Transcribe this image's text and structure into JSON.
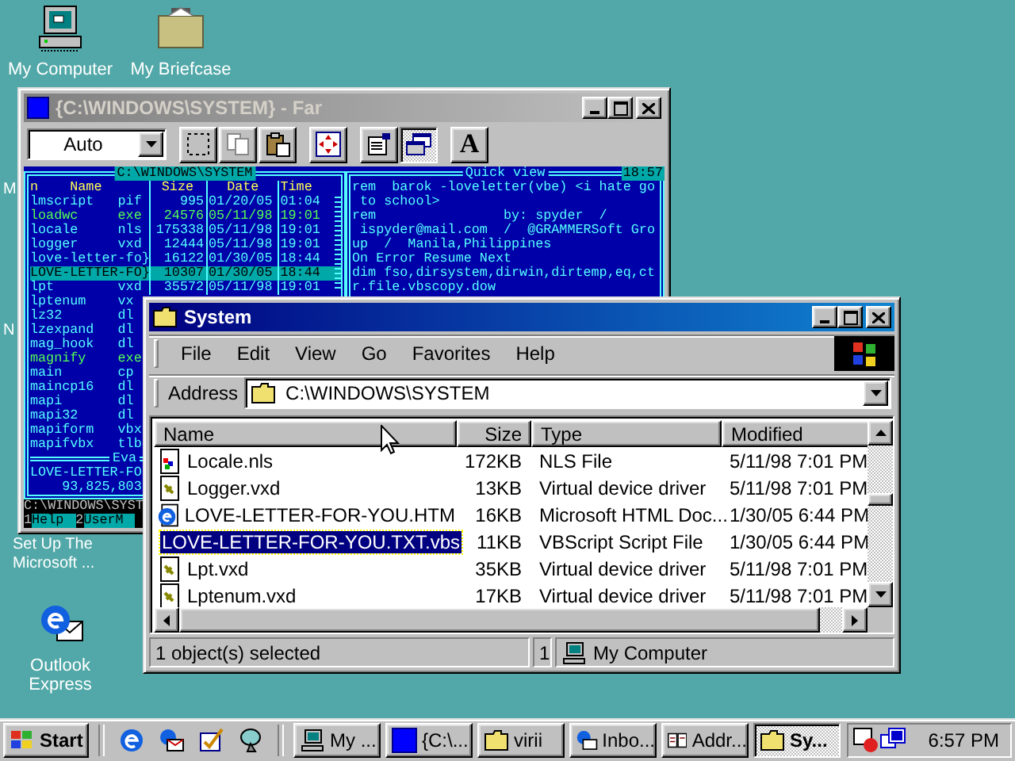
{
  "desktop": {
    "icons": [
      {
        "label": "My Computer",
        "kind": "computer"
      },
      {
        "label": "My Briefcase",
        "kind": "briefcase"
      },
      {
        "label": "M",
        "kind": "covered"
      },
      {
        "label": "N",
        "kind": "covered"
      },
      {
        "label": "Set Up The Microsoft ...",
        "kind": "covered"
      },
      {
        "label": "Outlook Express",
        "kind": "outlook"
      }
    ]
  },
  "far": {
    "title": "{C:\\WINDOWS\\SYSTEM} - Far",
    "view_mode": "Auto",
    "font_button": "A",
    "left_panel": {
      "path": "C:\\WINDOWS\\SYSTEM",
      "columns": [
        "n",
        "Name",
        "Size",
        "Date",
        "Time"
      ],
      "rows": [
        {
          "name": "lmscript",
          "ext": "pif",
          "size": "995",
          "date": "01/20/05",
          "time": "01:04",
          "color": "#55ffff",
          "selected": false
        },
        {
          "name": "loadwc",
          "ext": "exe",
          "size": "24576",
          "date": "05/11/98",
          "time": "19:01",
          "color": "#55ff55",
          "selected": false
        },
        {
          "name": "locale",
          "ext": "nls",
          "size": "175338",
          "date": "05/11/98",
          "time": "19:01",
          "color": "#55ffff",
          "selected": false
        },
        {
          "name": "logger",
          "ext": "vxd",
          "size": "12444",
          "date": "05/11/98",
          "time": "19:01",
          "color": "#55ffff",
          "selected": false
        },
        {
          "name": "love-letter-fo}",
          "size": "16122",
          "date": "01/30/05",
          "time": "18:44",
          "color": "#55ffff",
          "selected": false
        },
        {
          "name": "LOVE-LETTER-FO}",
          "size": "10307",
          "date": "01/30/05",
          "time": "18:44",
          "selected": true
        },
        {
          "name": "lpt",
          "ext": "vxd",
          "size": "35572",
          "date": "05/11/98",
          "time": "19:01",
          "color": "#55ffff",
          "selected": false
        },
        {
          "name": "lptenum",
          "ext": "vx",
          "color": "#55ffff",
          "selected": false
        },
        {
          "name": "lz32",
          "ext": "dl",
          "color": "#55ffff",
          "selected": false
        },
        {
          "name": "lzexpand",
          "ext": "dl",
          "color": "#55ffff",
          "selected": false
        },
        {
          "name": "mag_hook",
          "ext": "dl",
          "color": "#55ffff",
          "selected": false
        },
        {
          "name": "magnify",
          "ext": "exe",
          "color": "#55ff55",
          "selected": false
        },
        {
          "name": "main",
          "ext": "cp",
          "color": "#55ffff",
          "selected": false
        },
        {
          "name": "maincp16",
          "ext": "dl",
          "color": "#55ffff",
          "selected": false
        },
        {
          "name": "mapi",
          "ext": "dl",
          "color": "#55ffff",
          "selected": false
        },
        {
          "name": "mapi32",
          "ext": "dl",
          "color": "#55ffff",
          "selected": false
        },
        {
          "name": "mapiform",
          "ext": "vbx",
          "color": "#55ffff",
          "selected": false
        },
        {
          "name": "mapifvbx",
          "ext": "tlb",
          "color": "#55ffff",
          "selected": false
        }
      ],
      "info": "Eva",
      "current": "LOVE-LETTER-FO",
      "total": "93,825,803"
    },
    "quick_view": {
      "title": "Quick view",
      "clock": "18:57",
      "lines": [
        "rem  barok -loveletter(vbe) <i hate go",
        " to school>",
        "rem                by: spyder  /",
        " ispyder@mail.com  /  @GRAMMERSoft Gro",
        "up  /  Manila,Philippines",
        "On Error Resume Next",
        "dim fso,dirsystem,dirwin,dirtemp,eq,ct",
        "r.file.vbscopy.dow"
      ]
    },
    "command_line": "C:\\WINDOWS\\SYST",
    "keybar": [
      {
        "number": "1",
        "label": "Help"
      },
      {
        "number": "2",
        "label": "UserM"
      }
    ]
  },
  "explorer": {
    "title": "System",
    "menu": [
      "File",
      "Edit",
      "View",
      "Go",
      "Favorites",
      "Help"
    ],
    "address": {
      "label": "Address",
      "value": "C:\\WINDOWS\\SYSTEM"
    },
    "columns": [
      "Name",
      "Size",
      "Type",
      "Modified"
    ],
    "rows": [
      {
        "name": "Locale.nls",
        "size": "172KB",
        "type": "NLS File",
        "modified": "5/11/98 7:01 PM",
        "kind": "nls",
        "selected": false
      },
      {
        "name": "Logger.vxd",
        "size": "13KB",
        "type": "Virtual device driver",
        "modified": "5/11/98 7:01 PM",
        "kind": "vxd",
        "selected": false
      },
      {
        "name": "LOVE-LETTER-FOR-YOU.HTM",
        "size": "16KB",
        "type": "Microsoft HTML Doc...",
        "modified": "1/30/05 6:44 PM",
        "kind": "htm",
        "selected": false
      },
      {
        "name": "LOVE-LETTER-FOR-YOU.TXT.vbs",
        "size": "11KB",
        "type": "VBScript Script File",
        "modified": "1/30/05 6:44 PM",
        "kind": "vbs",
        "selected": true
      },
      {
        "name": "Lpt.vxd",
        "size": "35KB",
        "type": "Virtual device driver",
        "modified": "5/11/98 7:01 PM",
        "kind": "vxd",
        "selected": false
      },
      {
        "name": "Lptenum.vxd",
        "size": "17KB",
        "type": "Virtual device driver",
        "modified": "5/11/98 7:01 PM",
        "kind": "vxd",
        "selected": false
      }
    ],
    "status": {
      "selection": "1 object(s) selected",
      "count": "1",
      "zone": "My Computer"
    }
  },
  "taskbar": {
    "start": "Start",
    "tasks": [
      {
        "label": "My ...",
        "kind": "computer",
        "selected": false
      },
      {
        "label": "{C:\\...",
        "kind": "console",
        "selected": false
      },
      {
        "label": "virii",
        "kind": "folder",
        "selected": false
      },
      {
        "label": "Inbo...",
        "kind": "mail",
        "selected": false
      },
      {
        "label": "Addr...",
        "kind": "book",
        "selected": false
      },
      {
        "label": "Sy...",
        "kind": "folder",
        "selected": true
      }
    ],
    "clock": "6:57 PM"
  }
}
